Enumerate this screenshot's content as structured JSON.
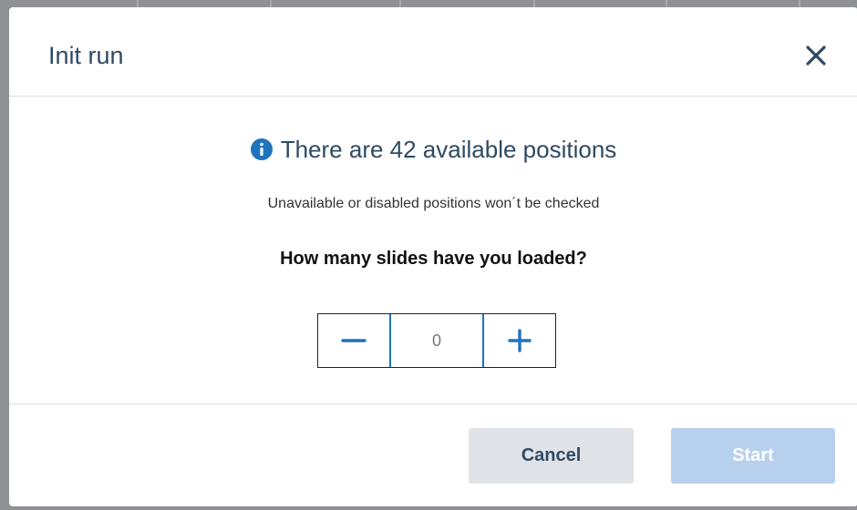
{
  "dialog": {
    "title": "Init run",
    "close_icon": "close-icon"
  },
  "info": {
    "icon": "info-icon",
    "message": "There are 42 available positions",
    "subtext": "Unavailable or disabled positions won´t be checked"
  },
  "question": "How many slides have you loaded?",
  "stepper": {
    "decrement_icon": "minus-icon",
    "value": "0",
    "increment_icon": "plus-icon"
  },
  "footer": {
    "cancel_label": "Cancel",
    "start_label": "Start"
  },
  "colors": {
    "title": "#2f4a63",
    "accent": "#1e73be",
    "cancel_bg": "#dfe3e8",
    "start_disabled_bg": "#b7d0ee"
  }
}
